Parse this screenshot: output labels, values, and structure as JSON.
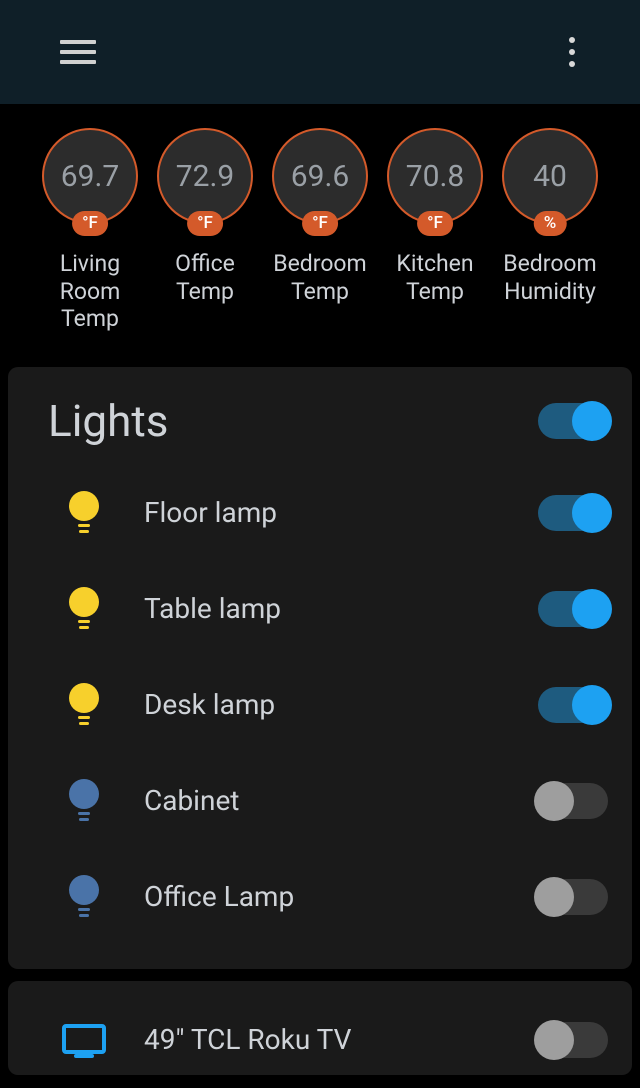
{
  "sensors": [
    {
      "value": "69.7",
      "unit": "°F",
      "label": "Living\nRoom\nTemp"
    },
    {
      "value": "72.9",
      "unit": "°F",
      "label": "Office\nTemp"
    },
    {
      "value": "69.6",
      "unit": "°F",
      "label": "Bedroom\nTemp"
    },
    {
      "value": "70.8",
      "unit": "°F",
      "label": "Kitchen\nTemp"
    },
    {
      "value": "40",
      "unit": "%",
      "label": "Bedroom\nHumidity"
    }
  ],
  "lights": {
    "title": "Lights",
    "master_on": true,
    "items": [
      {
        "label": "Floor lamp",
        "on": true
      },
      {
        "label": "Table lamp",
        "on": true
      },
      {
        "label": "Desk lamp",
        "on": true
      },
      {
        "label": "Cabinet",
        "on": false
      },
      {
        "label": "Office Lamp",
        "on": false
      }
    ]
  },
  "media": {
    "items": [
      {
        "label": "49\" TCL Roku TV",
        "on": false
      }
    ]
  }
}
